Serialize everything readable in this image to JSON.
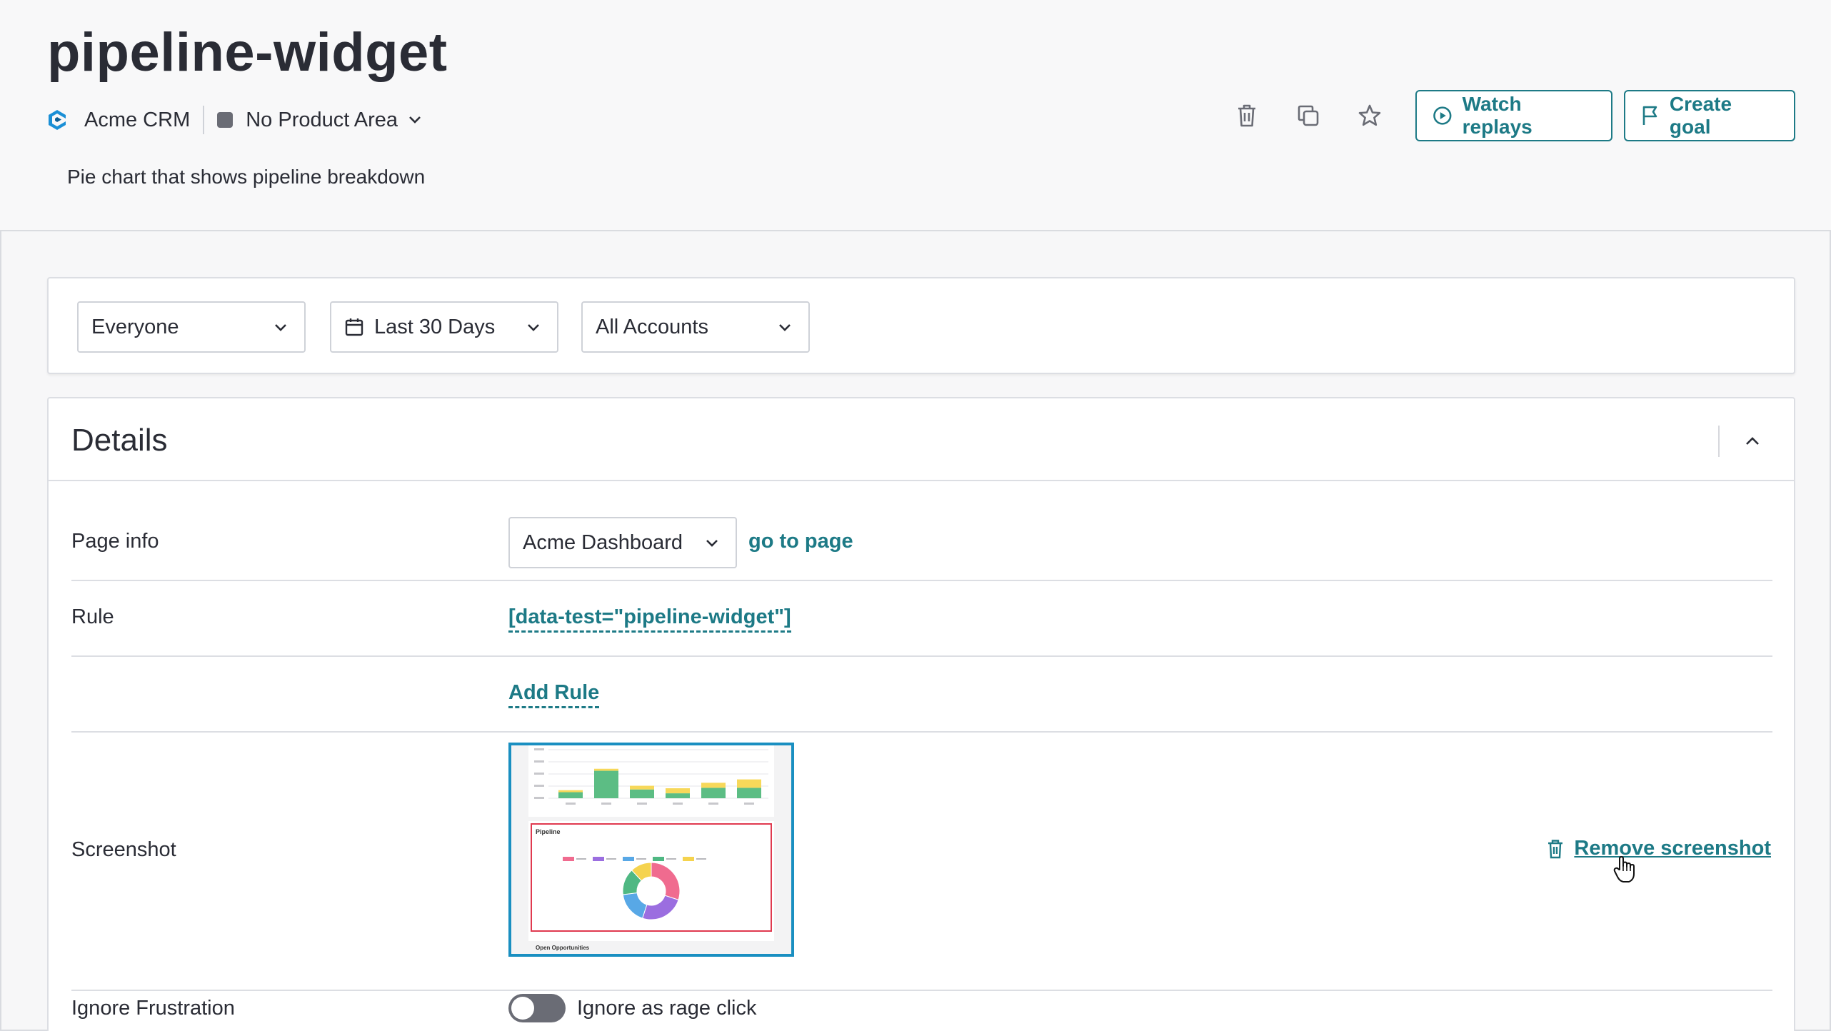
{
  "header": {
    "title": "pipeline-widget",
    "app_name": "Acme CRM",
    "product_area": "No Product Area",
    "description": "Pie chart that shows pipeline breakdown",
    "watch_replays_label": "Watch replays",
    "create_goal_label": "Create goal"
  },
  "filters": {
    "segment": "Everyone",
    "date_range": "Last 30 Days",
    "accounts": "All Accounts"
  },
  "details": {
    "title": "Details",
    "page_info_label": "Page info",
    "page_value": "Acme Dashboard",
    "go_to_page": "go to page",
    "rule_label": "Rule",
    "rule_value": "[data-test=\"pipeline-widget\"]",
    "add_rule": "Add Rule",
    "screenshot_label": "Screenshot",
    "remove_screenshot": "Remove screenshot",
    "ignore_frustration_label": "Ignore Frustration",
    "ignore_rage_click": "Ignore as rage click",
    "ignore_rage_click_enabled": false
  },
  "thumbnail": {
    "card_title": "Pipeline",
    "footer": "Open Opportunities",
    "legend": [
      "",
      "",
      "",
      "",
      ""
    ],
    "bars": [
      {
        "green": 0.22,
        "yellow": 0.12
      },
      {
        "green": 1.0,
        "yellow": 0.12
      },
      {
        "green": 0.32,
        "yellow": 0.22
      },
      {
        "green": 0.18,
        "yellow": 0.3
      },
      {
        "green": 0.38,
        "yellow": 0.3
      },
      {
        "green": 0.38,
        "yellow": 0.5
      }
    ],
    "donut": [
      {
        "color": "#f06b8f",
        "value": 30
      },
      {
        "color": "#9b6ee0",
        "value": 25
      },
      {
        "color": "#58a8e6",
        "value": 18
      },
      {
        "color": "#4fb883",
        "value": 15
      },
      {
        "color": "#f5d34e",
        "value": 12
      }
    ]
  },
  "colors": {
    "accent": "#1d7a86",
    "screenshot_border": "#1a8fc1",
    "bar_green": "#5cbd84",
    "bar_yellow": "#f7d85a"
  }
}
